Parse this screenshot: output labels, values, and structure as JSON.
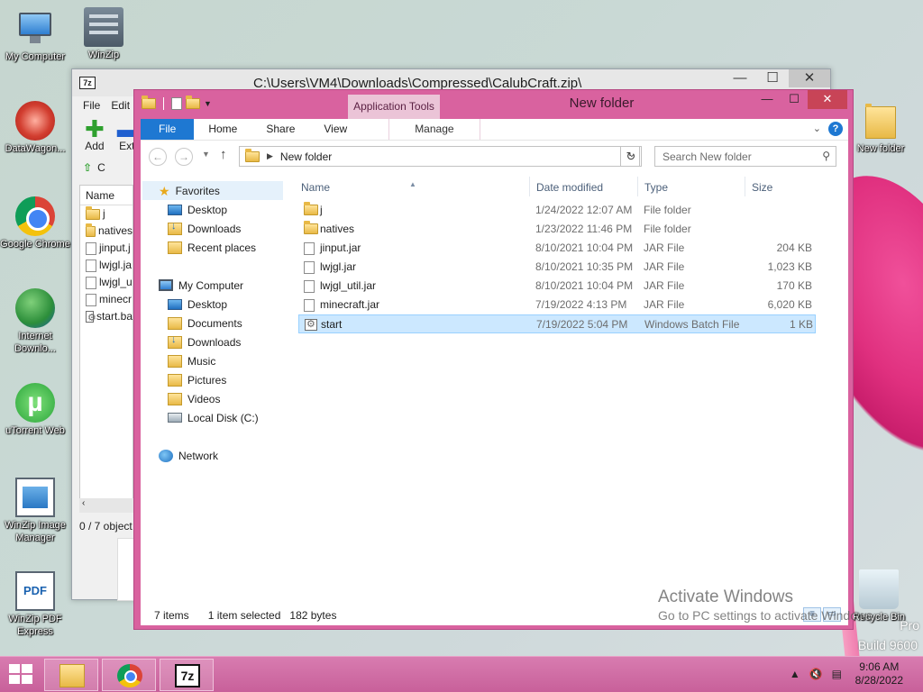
{
  "desktop": {
    "icons": [
      {
        "label": "My Computer",
        "icon": "computer-icon"
      },
      {
        "label": "WinZip",
        "icon": "winzip-icon"
      },
      {
        "label": "DataWagon...",
        "icon": "datawagon-icon"
      },
      {
        "label": "Google Chrome",
        "icon": "chrome-icon"
      },
      {
        "label": "Internet Downlo...",
        "icon": "idm-icon"
      },
      {
        "label": "uTorrent Web",
        "icon": "utorrent-icon"
      },
      {
        "label": "WinZip Image Manager",
        "icon": "winzip-image-icon"
      },
      {
        "label": "WinZip PDF Express",
        "icon": "pdf-icon"
      },
      {
        "label": "New folder",
        "icon": "folder-icon"
      },
      {
        "label": "Recycle Bin",
        "icon": "recycle-bin-icon"
      }
    ],
    "watermark": {
      "title": "Activate Windows",
      "subtitle": "Go to PC settings to activate Windows."
    },
    "build_edition": "Pro",
    "build": "Build 9600"
  },
  "zip_window": {
    "app_badge": "7z",
    "path": "C:\\Users\\VM4\\Downloads\\Compressed\\CalubCraft.zip\\",
    "menu": [
      "File",
      "Edit"
    ],
    "tools": [
      {
        "label": "Add"
      },
      {
        "label": "Extr"
      }
    ],
    "address_partial": "C",
    "list_header": "Name",
    "items": [
      "j",
      "natives",
      "jinput.j",
      "lwjgl.ja",
      "lwjgl_u",
      "minecr",
      "start.ba"
    ],
    "status": "0 / 7 object"
  },
  "explorer": {
    "title": "New folder",
    "contextual_tab_group": "Application Tools",
    "tabs": [
      "File",
      "Home",
      "Share",
      "View"
    ],
    "contextual_tab": "Manage",
    "address": "New folder",
    "search_placeholder": "Search New folder",
    "columns": {
      "name": "Name",
      "date": "Date modified",
      "type": "Type",
      "size": "Size"
    },
    "nav": {
      "favorites": "Favorites",
      "fav_items": [
        "Desktop",
        "Downloads",
        "Recent places"
      ],
      "computer": "My Computer",
      "computer_items": [
        "Desktop",
        "Documents",
        "Downloads",
        "Music",
        "Pictures",
        "Videos",
        "Local Disk (C:)"
      ],
      "network": "Network"
    },
    "files": [
      {
        "name": "j",
        "date": "1/24/2022 12:07 AM",
        "type": "File folder",
        "size": "",
        "kind": "folder"
      },
      {
        "name": "natives",
        "date": "1/23/2022 11:46 PM",
        "type": "File folder",
        "size": "",
        "kind": "folder"
      },
      {
        "name": "jinput.jar",
        "date": "8/10/2021 10:04 PM",
        "type": "JAR File",
        "size": "204 KB",
        "kind": "jar"
      },
      {
        "name": "lwjgl.jar",
        "date": "8/10/2021 10:35 PM",
        "type": "JAR File",
        "size": "1,023 KB",
        "kind": "jar"
      },
      {
        "name": "lwjgl_util.jar",
        "date": "8/10/2021 10:04 PM",
        "type": "JAR File",
        "size": "170 KB",
        "kind": "jar"
      },
      {
        "name": "minecraft.jar",
        "date": "7/19/2022 4:13 PM",
        "type": "JAR File",
        "size": "6,020 KB",
        "kind": "jar"
      },
      {
        "name": "start",
        "date": "7/19/2022 5:04 PM",
        "type": "Windows Batch File",
        "size": "1 KB",
        "kind": "bat",
        "selected": true
      }
    ],
    "status": {
      "count": "7 items",
      "selection": "1 item selected",
      "bytes": "182 bytes"
    }
  },
  "taskbar": {
    "time": "9:06 AM",
    "date": "8/28/2022",
    "badge_7z": "7z"
  },
  "colors": {
    "accent": "#d9629f",
    "file_tab": "#1e78d2",
    "selection": "#cce8ff"
  }
}
